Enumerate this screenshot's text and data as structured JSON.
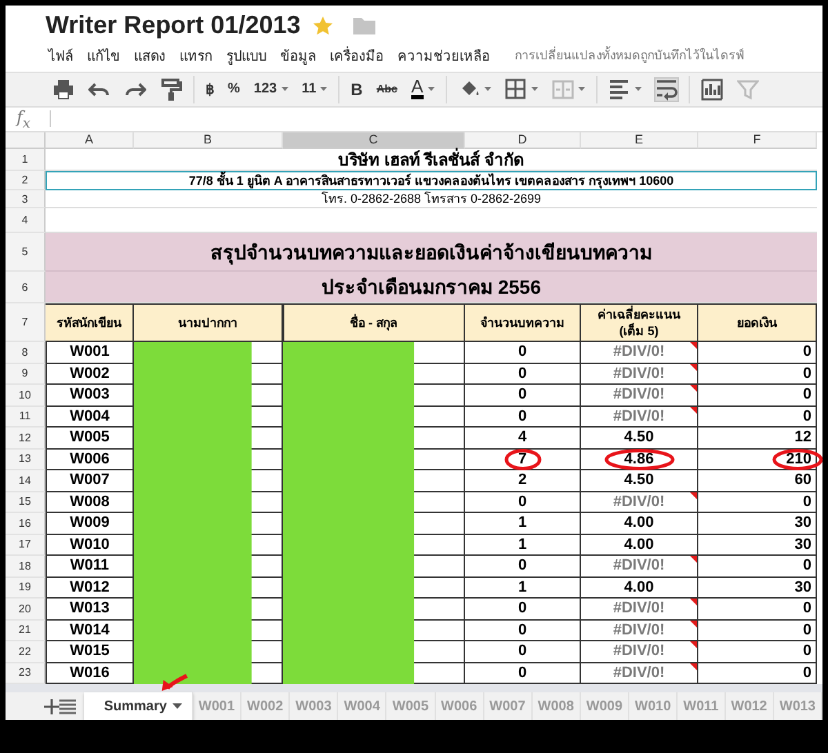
{
  "title": "Writer Report 01/2013",
  "starred": true,
  "menu": [
    "ไฟล์",
    "แก้ไข",
    "แสดง",
    "แทรก",
    "รูปแบบ",
    "ข้อมูล",
    "เครื่องมือ",
    "ความช่วยเหลือ"
  ],
  "save_status": "การเปลี่ยนแปลงทั้งหมดถูกบันทึกไว้ในไดรฟ์",
  "toolbar": [
    {
      "kind": "print",
      "disabled": false,
      "on": false
    },
    {
      "kind": "undo",
      "disabled": false,
      "on": false
    },
    {
      "kind": "redo",
      "disabled": false,
      "on": false
    },
    {
      "kind": "paint-format",
      "disabled": false,
      "on": false
    },
    {
      "kind": "text",
      "label": "฿",
      "disabled": false,
      "on": false
    },
    {
      "kind": "text",
      "label": "%",
      "disabled": false,
      "on": false
    },
    {
      "kind": "dropdown",
      "label": "123",
      "disabled": false,
      "on": false
    },
    {
      "kind": "dropdown",
      "label": "11",
      "disabled": false,
      "on": false
    },
    {
      "kind": "bold",
      "label": "B",
      "disabled": false,
      "on": false
    },
    {
      "kind": "strike",
      "label": "Abc",
      "disabled": false,
      "on": false
    },
    {
      "kind": "text-color",
      "label": "A",
      "disabled": false,
      "on": false
    },
    {
      "kind": "fill-color",
      "disabled": false,
      "on": false
    },
    {
      "kind": "borders",
      "disabled": false,
      "on": false
    },
    {
      "kind": "merge",
      "disabled": true,
      "on": false
    },
    {
      "kind": "align",
      "disabled": false,
      "on": false
    },
    {
      "kind": "wrap",
      "disabled": false,
      "on": true
    },
    {
      "kind": "chart",
      "disabled": false,
      "on": false
    },
    {
      "kind": "filter",
      "disabled": true,
      "on": false
    }
  ],
  "formula_bar": {
    "label": "f$_{x}$"
  },
  "columns": [
    {
      "label": "A",
      "selected": false
    },
    {
      "label": "B",
      "selected": false
    },
    {
      "label": "C",
      "selected": true
    },
    {
      "label": "D",
      "selected": false
    },
    {
      "label": "E",
      "selected": false
    },
    {
      "label": "F",
      "selected": false
    }
  ],
  "title_rows": [
    {
      "kind": "company",
      "number": "1",
      "text": "บริษัท เฮลท์ รีเลชั่นส์ จำกัด"
    },
    {
      "kind": "address",
      "number": "2",
      "text": "77/8 ชั้น 1 ยูนิต A อาคารสินสาธรทาวเวอร์ แขวงคลองต้นไทร เขตคลองสาร กรุงเทพฯ 10600"
    },
    {
      "kind": "phone",
      "number": "3",
      "text": "โทร. 0-2862-2688 โทรสาร 0-2862-2699"
    },
    {
      "kind": "blank",
      "number": "4",
      "text": ""
    },
    {
      "kind": "heading",
      "number": "5",
      "text": "สรุปจำนวนบทความและยอดเงินค่าจ้างเขียนบทความ"
    },
    {
      "kind": "subheading",
      "number": "6",
      "text": "ประจำเดือนมกราคม 2556"
    }
  ],
  "header_row": {
    "number": "7",
    "cells": [
      "รหัสนักเขียน",
      "นามปากกา",
      "ชื่อ - สกุล",
      "จำนวนบทความ",
      "ค่าเฉลี่ยคะแนน (เต็ม 5)",
      "ยอดเงิน"
    ]
  },
  "rows": [
    {
      "number": "8",
      "code": "W001",
      "count": "0",
      "avg": "#DIV/0!",
      "error": true,
      "amount": "0",
      "redacted": true
    },
    {
      "number": "9",
      "code": "W002",
      "count": "0",
      "avg": "#DIV/0!",
      "error": true,
      "amount": "0",
      "redacted": true
    },
    {
      "number": "10",
      "code": "W003",
      "count": "0",
      "avg": "#DIV/0!",
      "error": true,
      "amount": "0",
      "redacted": true
    },
    {
      "number": "11",
      "code": "W004",
      "count": "0",
      "avg": "#DIV/0!",
      "error": true,
      "amount": "0",
      "redacted": true
    },
    {
      "number": "12",
      "code": "W005",
      "count": "4",
      "avg": "4.50",
      "error": false,
      "amount": "12",
      "redacted": true
    },
    {
      "number": "13",
      "code": "W006",
      "count": "7",
      "avg": "4.86",
      "error": false,
      "amount": "210",
      "redacted": true,
      "circled": {
        "count": true,
        "avg": true,
        "amount": true
      }
    },
    {
      "number": "14",
      "code": "W007",
      "count": "2",
      "avg": "4.50",
      "error": false,
      "amount": "60",
      "redacted": true
    },
    {
      "number": "15",
      "code": "W008",
      "count": "0",
      "avg": "#DIV/0!",
      "error": true,
      "amount": "0",
      "redacted": true
    },
    {
      "number": "16",
      "code": "W009",
      "count": "1",
      "avg": "4.00",
      "error": false,
      "amount": "30",
      "redacted": true
    },
    {
      "number": "17",
      "code": "W010",
      "count": "1",
      "avg": "4.00",
      "error": false,
      "amount": "30",
      "redacted": true
    },
    {
      "number": "18",
      "code": "W011",
      "count": "0",
      "avg": "#DIV/0!",
      "error": true,
      "amount": "0",
      "redacted": true
    },
    {
      "number": "19",
      "code": "W012",
      "count": "1",
      "avg": "4.00",
      "error": false,
      "amount": "30",
      "redacted": true
    },
    {
      "number": "20",
      "code": "W013",
      "count": "0",
      "avg": "#DIV/0!",
      "error": true,
      "amount": "0",
      "redacted": true
    },
    {
      "number": "21",
      "code": "W014",
      "count": "0",
      "avg": "#DIV/0!",
      "error": true,
      "amount": "0",
      "redacted": true
    },
    {
      "number": "22",
      "code": "W015",
      "count": "0",
      "avg": "#DIV/0!",
      "error": true,
      "amount": "0",
      "redacted": true
    },
    {
      "number": "23",
      "code": "W016",
      "count": "0",
      "avg": "#DIV/0!",
      "error": true,
      "amount": "0",
      "redacted": true
    }
  ],
  "sheet_tabs": [
    {
      "label": "Summary",
      "selected": true,
      "arrow": true
    },
    {
      "label": "W001",
      "selected": false,
      "arrow": false
    },
    {
      "label": "W002",
      "selected": false,
      "arrow": false
    },
    {
      "label": "W003",
      "selected": false,
      "arrow": false
    },
    {
      "label": "W004",
      "selected": false,
      "arrow": false
    },
    {
      "label": "W005",
      "selected": false,
      "arrow": false
    },
    {
      "label": "W006",
      "selected": false,
      "arrow": false
    },
    {
      "label": "W007",
      "selected": false,
      "arrow": false
    },
    {
      "label": "W008",
      "selected": false,
      "arrow": false
    },
    {
      "label": "W009",
      "selected": false,
      "arrow": false
    },
    {
      "label": "W010",
      "selected": false,
      "arrow": false
    },
    {
      "label": "W011",
      "selected": false,
      "arrow": false
    },
    {
      "label": "W012",
      "selected": false,
      "arrow": false
    },
    {
      "label": "W013",
      "selected": false,
      "arrow": false
    }
  ]
}
